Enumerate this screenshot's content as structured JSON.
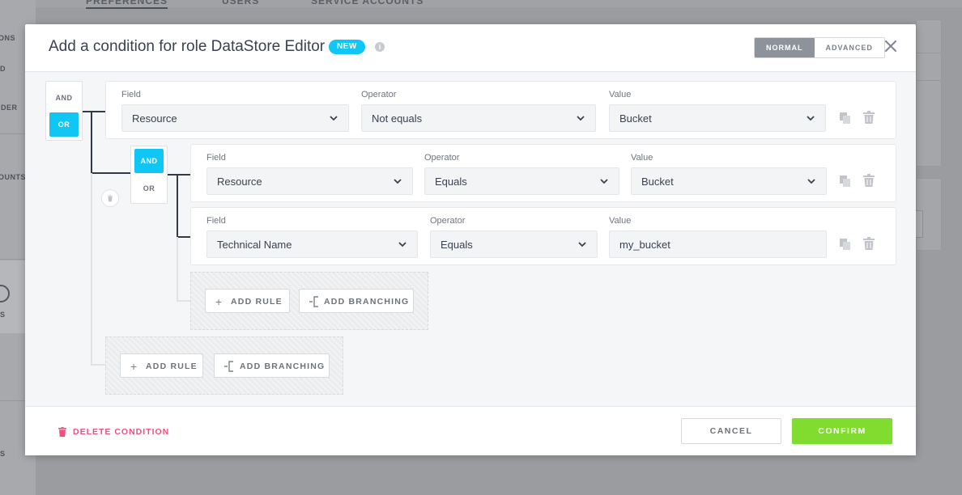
{
  "background": {
    "tabs": [
      "PREFERENCES",
      "USERS",
      "SERVICE ACCOUNTS"
    ],
    "sidebar_fragments": [
      "ONS",
      "D",
      "IDER",
      "OUNTS",
      "S",
      "S"
    ]
  },
  "modal": {
    "title": "Add a condition for role DataStore Editor",
    "badge": "NEW",
    "info_icon": "info-icon",
    "modes": [
      "NORMAL",
      "ADVANCED"
    ],
    "active_mode": "NORMAL",
    "close_icon": "close-icon"
  },
  "tree": {
    "root_operator": {
      "options": [
        "AND",
        "OR"
      ],
      "selected": "OR"
    },
    "root_rule": {
      "field_label": "Field",
      "field": "Resource",
      "operator_label": "Operator",
      "operator": "Not equals",
      "value_label": "Value",
      "value": "Bucket"
    },
    "group": {
      "operator": {
        "options": [
          "AND",
          "OR"
        ],
        "selected": "AND"
      },
      "rules": [
        {
          "field_label": "Field",
          "field": "Resource",
          "operator_label": "Operator",
          "operator": "Equals",
          "value_label": "Value",
          "value": "Bucket"
        },
        {
          "field_label": "Field",
          "field": "Technical Name",
          "operator_label": "Operator",
          "operator": "Equals",
          "value_label": "Value",
          "value": "my_bucket"
        }
      ],
      "add_rule": "ADD RULE",
      "add_branching": "ADD BRANCHING"
    },
    "add_rule": "ADD RULE",
    "add_branching": "ADD BRANCHING"
  },
  "footer": {
    "delete_condition": "DELETE CONDITION",
    "cancel": "CANCEL",
    "confirm": "CONFIRM"
  },
  "colors": {
    "accent_blue": "#10c6f5",
    "confirm_green": "#80dd2f",
    "delete_pink": "#f0507d"
  }
}
